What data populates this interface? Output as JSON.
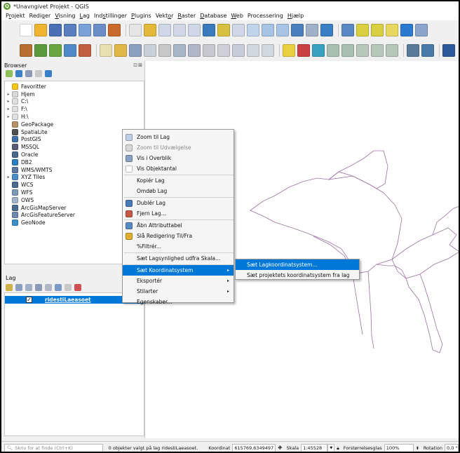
{
  "window": {
    "title": "*Unavngivet Projekt - QGIS"
  },
  "menubar": [
    {
      "pre": "P",
      "u": "r",
      "post": "ojekt"
    },
    {
      "pre": "Redi",
      "u": "g",
      "post": "er"
    },
    {
      "pre": "",
      "u": "V",
      "post": "isning"
    },
    {
      "pre": "",
      "u": "L",
      "post": "ag"
    },
    {
      "pre": "Ind",
      "u": "s",
      "post": "tillinger"
    },
    {
      "pre": "",
      "u": "P",
      "post": "lugins"
    },
    {
      "pre": "Vekt",
      "u": "o",
      "post": "r"
    },
    {
      "pre": "",
      "u": "R",
      "post": "aster"
    },
    {
      "pre": "",
      "u": "D",
      "post": "atabase"
    },
    {
      "pre": "",
      "u": "W",
      "post": "eb"
    },
    {
      "pre": "Processering",
      "u": "",
      "post": ""
    },
    {
      "pre": "",
      "u": "H",
      "post": "jælp"
    }
  ],
  "toolbar1": [
    {
      "name": "new-project-icon",
      "color": "#ffffff"
    },
    {
      "name": "open-project-icon",
      "color": "#f0b530"
    },
    {
      "name": "save-project-icon",
      "color": "#4a6fb5"
    },
    {
      "name": "save-as-icon",
      "color": "#5a7fc0"
    },
    {
      "name": "new-layout-icon",
      "color": "#7aa0d8"
    },
    {
      "name": "layout-manager-icon",
      "color": "#6c8ec8"
    },
    {
      "name": "style-manager-icon",
      "color": "#c96b2c"
    },
    {
      "sep": true
    },
    {
      "name": "pan-icon",
      "color": "#e6e6e6"
    },
    {
      "name": "pan-to-selection-icon",
      "color": "#e2b93b"
    },
    {
      "name": "zoom-in-icon",
      "color": "#d0d8e8"
    },
    {
      "name": "zoom-out-icon",
      "color": "#d0d8e8"
    },
    {
      "name": "zoom-rubberband-icon",
      "color": "#d0d8e8"
    },
    {
      "name": "zoom-full-icon",
      "color": "#3a7bbd"
    },
    {
      "name": "zoom-selection-icon",
      "color": "#d8c040"
    },
    {
      "name": "zoom-layer-icon",
      "color": "#d0d8e8"
    },
    {
      "name": "zoom-native-icon",
      "color": "#c0d4ec"
    },
    {
      "name": "zoom-last-icon",
      "color": "#a8c4e4"
    },
    {
      "name": "zoom-next-icon",
      "color": "#a8c4e4"
    },
    {
      "name": "new-map-view-icon",
      "color": "#4a80c0"
    },
    {
      "name": "bookmark-icon",
      "color": "#9fb0c8"
    },
    {
      "name": "refresh-icon",
      "color": "#3a7fc4"
    },
    {
      "sep": true
    },
    {
      "name": "identify-icon",
      "color": "#5a8ac4"
    },
    {
      "name": "select-features-icon",
      "color": "#d8d040"
    },
    {
      "name": "select-area-icon",
      "color": "#d8d040"
    },
    {
      "name": "deselect-icon",
      "color": "#e8d860"
    },
    {
      "name": "field-calculator-icon",
      "color": "#2a7ad0"
    },
    {
      "name": "statistics-icon",
      "color": "#8aa4cc"
    }
  ],
  "toolbar2": [
    {
      "name": "data-source-manager-icon",
      "color": "#b86e2e"
    },
    {
      "name": "new-layer-icon",
      "color": "#5a9a3a"
    },
    {
      "name": "add-vector-icon",
      "color": "#6aa640"
    },
    {
      "name": "add-delimited-text-icon",
      "color": "#4f8bc8"
    },
    {
      "name": "add-raster-icon",
      "color": "#c06040"
    },
    {
      "sep": true
    },
    {
      "name": "pencil-icon",
      "color": "#e8e0b0"
    },
    {
      "name": "edit-toggle-icon",
      "color": "#e0b848"
    },
    {
      "name": "save-edits-icon",
      "color": "#8aa0c0"
    },
    {
      "name": "digitize-icon",
      "color": "#c8d0d8"
    },
    {
      "name": "vertex-tool-icon",
      "color": "#c8c8c8"
    },
    {
      "name": "move-feature-icon",
      "color": "#a8b8c8"
    },
    {
      "name": "delete-selected-icon",
      "color": "#b0b8c8"
    },
    {
      "name": "cut-features-icon",
      "color": "#c8c8d0"
    },
    {
      "name": "copy-features-icon",
      "color": "#d0d0d8"
    },
    {
      "name": "paste-features-icon",
      "color": "#c8ccd8"
    },
    {
      "name": "undo-icon",
      "color": "#d0d8e0"
    },
    {
      "name": "redo-icon",
      "color": "#d0d8e0"
    },
    {
      "sep": true
    },
    {
      "name": "label-toolbar-icon",
      "color": "#e8d040"
    },
    {
      "name": "layer-labeling-icon",
      "color": "#c84040"
    },
    {
      "name": "diagram-icon",
      "color": "#3aa0c0"
    },
    {
      "name": "pin-labels-icon",
      "color": "#a8c0b0"
    },
    {
      "name": "show-hide-labels-icon",
      "color": "#a8c0b0"
    },
    {
      "name": "move-label-icon",
      "color": "#b8c8b8"
    },
    {
      "name": "rotate-label-icon",
      "color": "#b8c8b8"
    },
    {
      "name": "change-label-icon",
      "color": "#b8c8b8"
    },
    {
      "sep": true
    },
    {
      "name": "gps-icon",
      "color": "#5a7a9a"
    },
    {
      "name": "python-console-icon",
      "color": "#4a7aaa"
    },
    {
      "sep": true
    },
    {
      "name": "plugin-icon",
      "color": "#2a5a9a"
    }
  ],
  "browser": {
    "title": "Browser",
    "controls": "⊡⊠",
    "items": [
      {
        "label": "Favoritter",
        "icon": "star-icon",
        "color": "#f5c518",
        "arrow": ""
      },
      {
        "label": "Hjem",
        "icon": "home-folder-icon",
        "color": "#d8d8d8",
        "arrow": "▸"
      },
      {
        "label": "C:\\",
        "icon": "folder-icon",
        "color": "#e0e0e0",
        "arrow": "▸"
      },
      {
        "label": "F:\\",
        "icon": "folder-icon",
        "color": "#e0e0e0",
        "arrow": "▸"
      },
      {
        "label": "H:\\",
        "icon": "folder-icon",
        "color": "#e0e0e0",
        "arrow": "▸"
      },
      {
        "label": "GeoPackage",
        "icon": "geopackage-icon",
        "color": "#b5916a",
        "arrow": ""
      },
      {
        "label": "SpatiaLite",
        "icon": "spatialite-icon",
        "color": "#505050",
        "arrow": ""
      },
      {
        "label": "PostGIS",
        "icon": "postgis-icon",
        "color": "#3e6ea5",
        "arrow": ""
      },
      {
        "label": "MSSQL",
        "icon": "mssql-icon",
        "color": "#5a5a7a",
        "arrow": ""
      },
      {
        "label": "Oracle",
        "icon": "oracle-icon",
        "color": "#4a6a8a",
        "arrow": ""
      },
      {
        "label": "DB2",
        "icon": "db2-icon",
        "color": "#2a80c0",
        "arrow": ""
      },
      {
        "label": "WMS/WMTS",
        "icon": "wms-icon",
        "color": "#5a7aa0",
        "arrow": ""
      },
      {
        "label": "XYZ Tiles",
        "icon": "xyz-tiles-icon",
        "color": "#4a90c8",
        "arrow": "▸"
      },
      {
        "label": "WCS",
        "icon": "wcs-icon",
        "color": "#4a6a90",
        "arrow": ""
      },
      {
        "label": "WFS",
        "icon": "wfs-icon",
        "color": "#7a9ab8",
        "arrow": ""
      },
      {
        "label": "OWS",
        "icon": "ows-icon",
        "color": "#a0b4cc",
        "arrow": ""
      },
      {
        "label": "ArcGisMapServer",
        "icon": "arcgis-map-icon",
        "color": "#4a6a90",
        "arrow": ""
      },
      {
        "label": "ArcGisFeatureServer",
        "icon": "arcgis-feature-icon",
        "color": "#6a8ab0",
        "arrow": ""
      },
      {
        "label": "GeoNode",
        "icon": "geonode-icon",
        "color": "#3a90c8",
        "arrow": ""
      }
    ]
  },
  "layers": {
    "title": "Lag",
    "items": [
      {
        "label": "ridestiLaeasoet",
        "checked": "✓"
      }
    ]
  },
  "context_menu": {
    "items": [
      {
        "label": "Zoom til Lag",
        "icon": "zoom-layer-icon",
        "color": "#c0d0e8"
      },
      {
        "label": "Zoom til Udvælgelse",
        "icon": "zoom-selection-icon",
        "color": "#d8d8d8",
        "disabled": true
      },
      {
        "label": "Vis i Overblik",
        "icon": "overview-icon",
        "color": "#8aa0c0"
      },
      {
        "label": "Vis Objektantal",
        "icon": "checkbox-icon",
        "color": "#ffffff"
      },
      {
        "label": "Kopiér Lag",
        "icon": "",
        "color": ""
      },
      {
        "label": "Omdøb Lag",
        "icon": "",
        "color": ""
      },
      {
        "label": "Dublér Lag",
        "icon": "duplicate-layer-icon",
        "color": "#4a7ab8"
      },
      {
        "label": "Fjern Lag...",
        "icon": "remove-layer-icon",
        "color": "#c85a4a"
      },
      {
        "label": "Åbn Attributtabel",
        "icon": "attribute-table-icon",
        "color": "#5a8ac4"
      },
      {
        "label": "Slå Redigering Til/Fra",
        "icon": "pencil-icon",
        "color": "#e0b030"
      },
      {
        "label": "%Filtrér...",
        "icon": "",
        "color": ""
      },
      {
        "label": "Sæt Lagsynlighed udfra Skala...",
        "icon": "",
        "color": ""
      },
      {
        "label": "Sæt Koordinatsystem",
        "icon": "",
        "color": "",
        "submenu": "▸",
        "active": true
      },
      {
        "label": "Eksportér",
        "icon": "",
        "color": "",
        "submenu": "▸"
      },
      {
        "label": "Stilarter",
        "icon": "",
        "color": "",
        "submenu": "▸"
      },
      {
        "label": "Egenskaber...",
        "icon": "",
        "color": ""
      }
    ]
  },
  "submenu": {
    "items": [
      {
        "label": "Sæt Lagkoordinatsystem...",
        "active": true
      },
      {
        "label": "Sæt projektets koordinatsystem fra lag"
      }
    ]
  },
  "statusbar": {
    "search_placeholder": "Skriv for at finde (Ctrl+K)",
    "message": "0 objekter valgt på lag ridestiLaeasoet.",
    "coord_label": "Koordinat",
    "coord_value": "615769,6349497",
    "scale_label": "Skala",
    "scale_value": "1:45528",
    "magnifier_label": "Forstørrelsesglas",
    "magnifier_value": "100%",
    "rotation_label": "Rotation",
    "rotation_value": "0,0 °"
  },
  "colors": {
    "selection": "#0078d7",
    "polygon_stroke": "#a070a8"
  }
}
